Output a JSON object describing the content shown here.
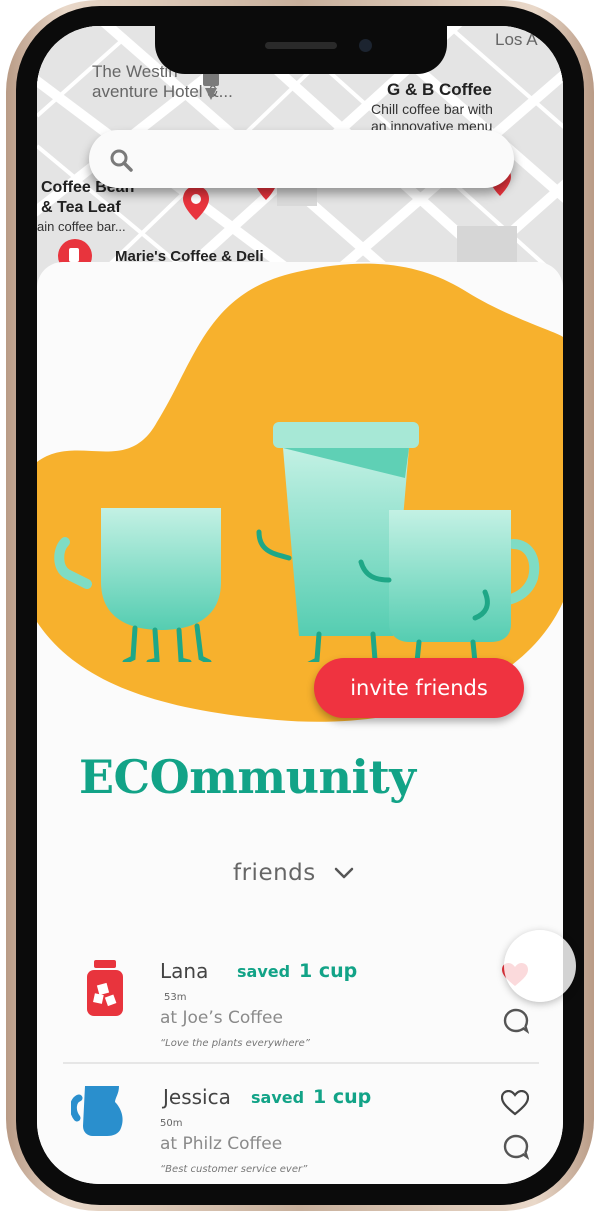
{
  "map": {
    "labels": {
      "la": "Los A",
      "westin_line1": "The Westin",
      "westin_line2": "aventure Hotel &...",
      "gb_title": "G & B Coffee",
      "gb_sub1": "Chill coffee bar with",
      "gb_sub2": "an innovative menu",
      "bean_line1": "Coffee Bean",
      "bean_line2": "& Tea Leaf",
      "bean_sub": "ain coffee bar...",
      "marie": "Marie's Coffee & Deli"
    }
  },
  "search": {
    "placeholder": "",
    "value": ""
  },
  "card": {
    "invite_label": "invite friends",
    "logo": "ECOmmunity",
    "filter_label": "friends"
  },
  "feed": [
    {
      "name": "Lana",
      "saved": "saved",
      "count": "1 cup",
      "time": "53m",
      "place": "at Joe’s Coffee",
      "quote": "“Love the plants everywhere”",
      "liked": true
    },
    {
      "name": "Jessica",
      "saved": "saved",
      "count": "1 cup",
      "time": "50m",
      "place": "at Philz Coffee",
      "quote": "“Best customer service ever”",
      "liked": false
    }
  ],
  "colors": {
    "accent": "#12a387",
    "brand_red": "#ef3340",
    "blob_yellow": "#f7b12d",
    "cup_mint": "#7fdcc4",
    "jar_red": "#e8343d",
    "pitcher_blue": "#2a8fcd"
  },
  "icons": [
    "search-icon",
    "map-pin-icon",
    "jar-icon",
    "pitcher-icon",
    "heart-icon",
    "comment-icon",
    "chevron-down-icon"
  ]
}
